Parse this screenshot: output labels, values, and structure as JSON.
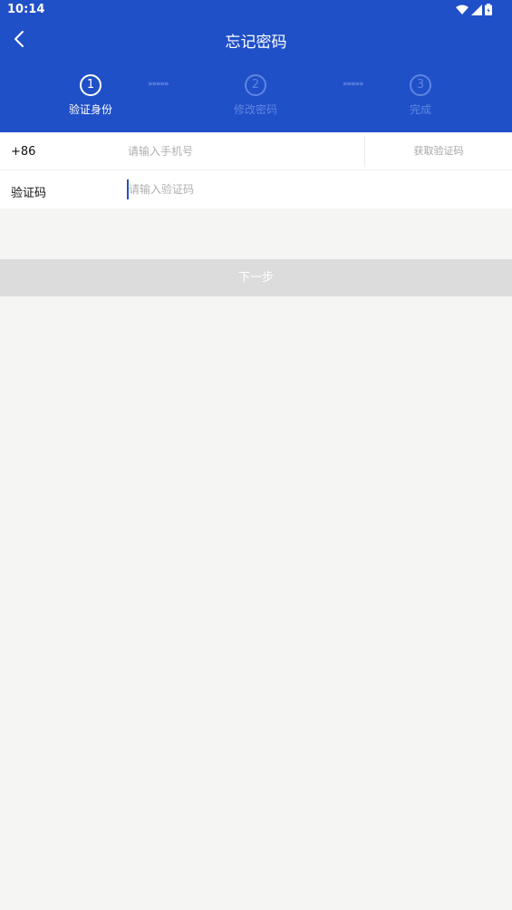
{
  "status_bar": {
    "time": "10:14"
  },
  "nav": {
    "title": "忘记密码"
  },
  "steps": [
    {
      "number": "1",
      "label": "验证身份",
      "state": "active"
    },
    {
      "number": "2",
      "label": "修改密码",
      "state": "inactive"
    },
    {
      "number": "3",
      "label": "完成",
      "state": "inactive"
    }
  ],
  "form": {
    "phone_label": "+86",
    "phone_placeholder": "请输入手机号",
    "get_code_label": "获取验证码",
    "code_label": "验证码",
    "code_placeholder": "请输入验证码"
  },
  "next_button": "下一步",
  "colors": {
    "primary": "#2050c8",
    "active_step": "#ffffff",
    "inactive_step": "#5d86e0",
    "disabled_button": "#dcdcdc",
    "background": "#f5f5f3"
  },
  "icons": [
    "back-arrow-icon",
    "wifi-icon",
    "signal-icon",
    "battery-icon",
    "step-chevron-icon"
  ]
}
